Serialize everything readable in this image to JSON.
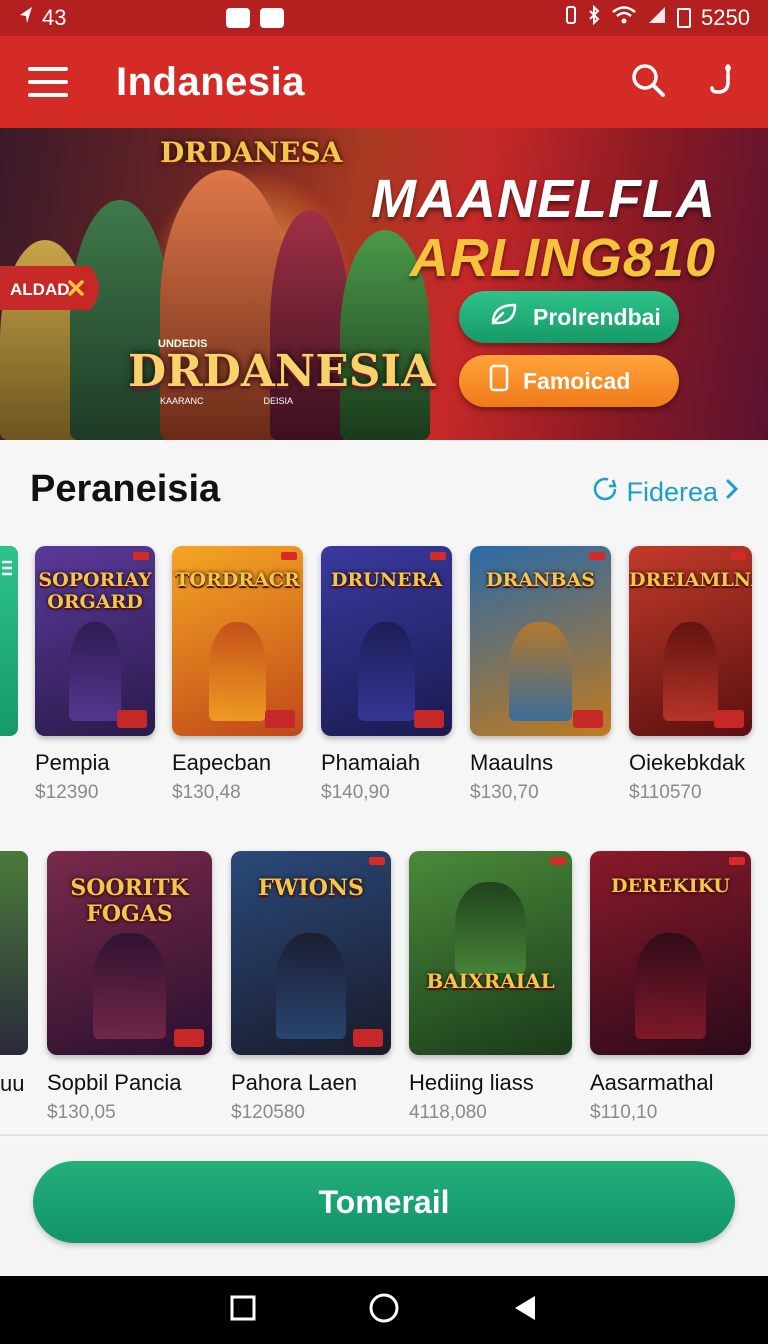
{
  "status_bar": {
    "time": "43",
    "right_text": "5250"
  },
  "app_bar": {
    "title": "Indanesia"
  },
  "banner": {
    "badge_label": "ALDAD",
    "logo_top": "DRDANESA",
    "logo_main": "DRDANESIA",
    "logo_sub": "UNDEDIS",
    "logo_tag_left": "KAARANC",
    "logo_tag_right": "DEISIA",
    "headline_line1": "MAANELFLA",
    "headline_line2": "ARLING810",
    "primary_button": "Prolrendbai",
    "secondary_button": "Famoicad"
  },
  "section": {
    "title": "Peraneisia",
    "link_label": "Fiderea"
  },
  "row1": [
    {
      "name": "Pempia",
      "price": "$12390",
      "logo": "SOPORIAY ORGARD",
      "colors": [
        "#5a3a9a",
        "#2a1a4a"
      ]
    },
    {
      "name": "Eapecban",
      "price": "$130,48",
      "logo": "TORDRACR",
      "colors": [
        "#f5a623",
        "#c0481a"
      ]
    },
    {
      "name": "Phamaiah",
      "price": "$140,90",
      "logo": "DRUNERA",
      "colors": [
        "#3a3aa0",
        "#1a1a50"
      ]
    },
    {
      "name": "Maaulns",
      "price": "$130,70",
      "logo": "DRANBAS",
      "colors": [
        "#2a6aa8",
        "#c07a20"
      ]
    },
    {
      "name": "Oiekebkdak",
      "price": "$110570",
      "logo": "DREIAMLNA",
      "colors": [
        "#c23a2a",
        "#5a1010"
      ]
    }
  ],
  "row2": [
    {
      "name": "Sopbil Pancia",
      "price": "$130,05",
      "logo": "SOORITK FOGAS",
      "colors": [
        "#7a2a4a",
        "#2a1030"
      ]
    },
    {
      "name": "Pahora Laen",
      "price": "$120580",
      "logo": "FWIONS",
      "colors": [
        "#2a4a7a",
        "#1a1a2a"
      ]
    },
    {
      "name": "Hediing liass",
      "price": "4118,080",
      "logo": "BAIXRAIAL",
      "colors": [
        "#4a8a3a",
        "#1a3a1a"
      ]
    },
    {
      "name": "Aasarmathal",
      "price": "$110,10",
      "logo": "DEREKIKU",
      "colors": [
        "#8a1a2a",
        "#2a0a1a"
      ]
    }
  ],
  "partial_row2_label": "uu",
  "cta_label": "Tomerail",
  "accent_colors": {
    "app_bar": "#d52b27",
    "cta": "#1aa574",
    "link": "#1aa0c8"
  }
}
